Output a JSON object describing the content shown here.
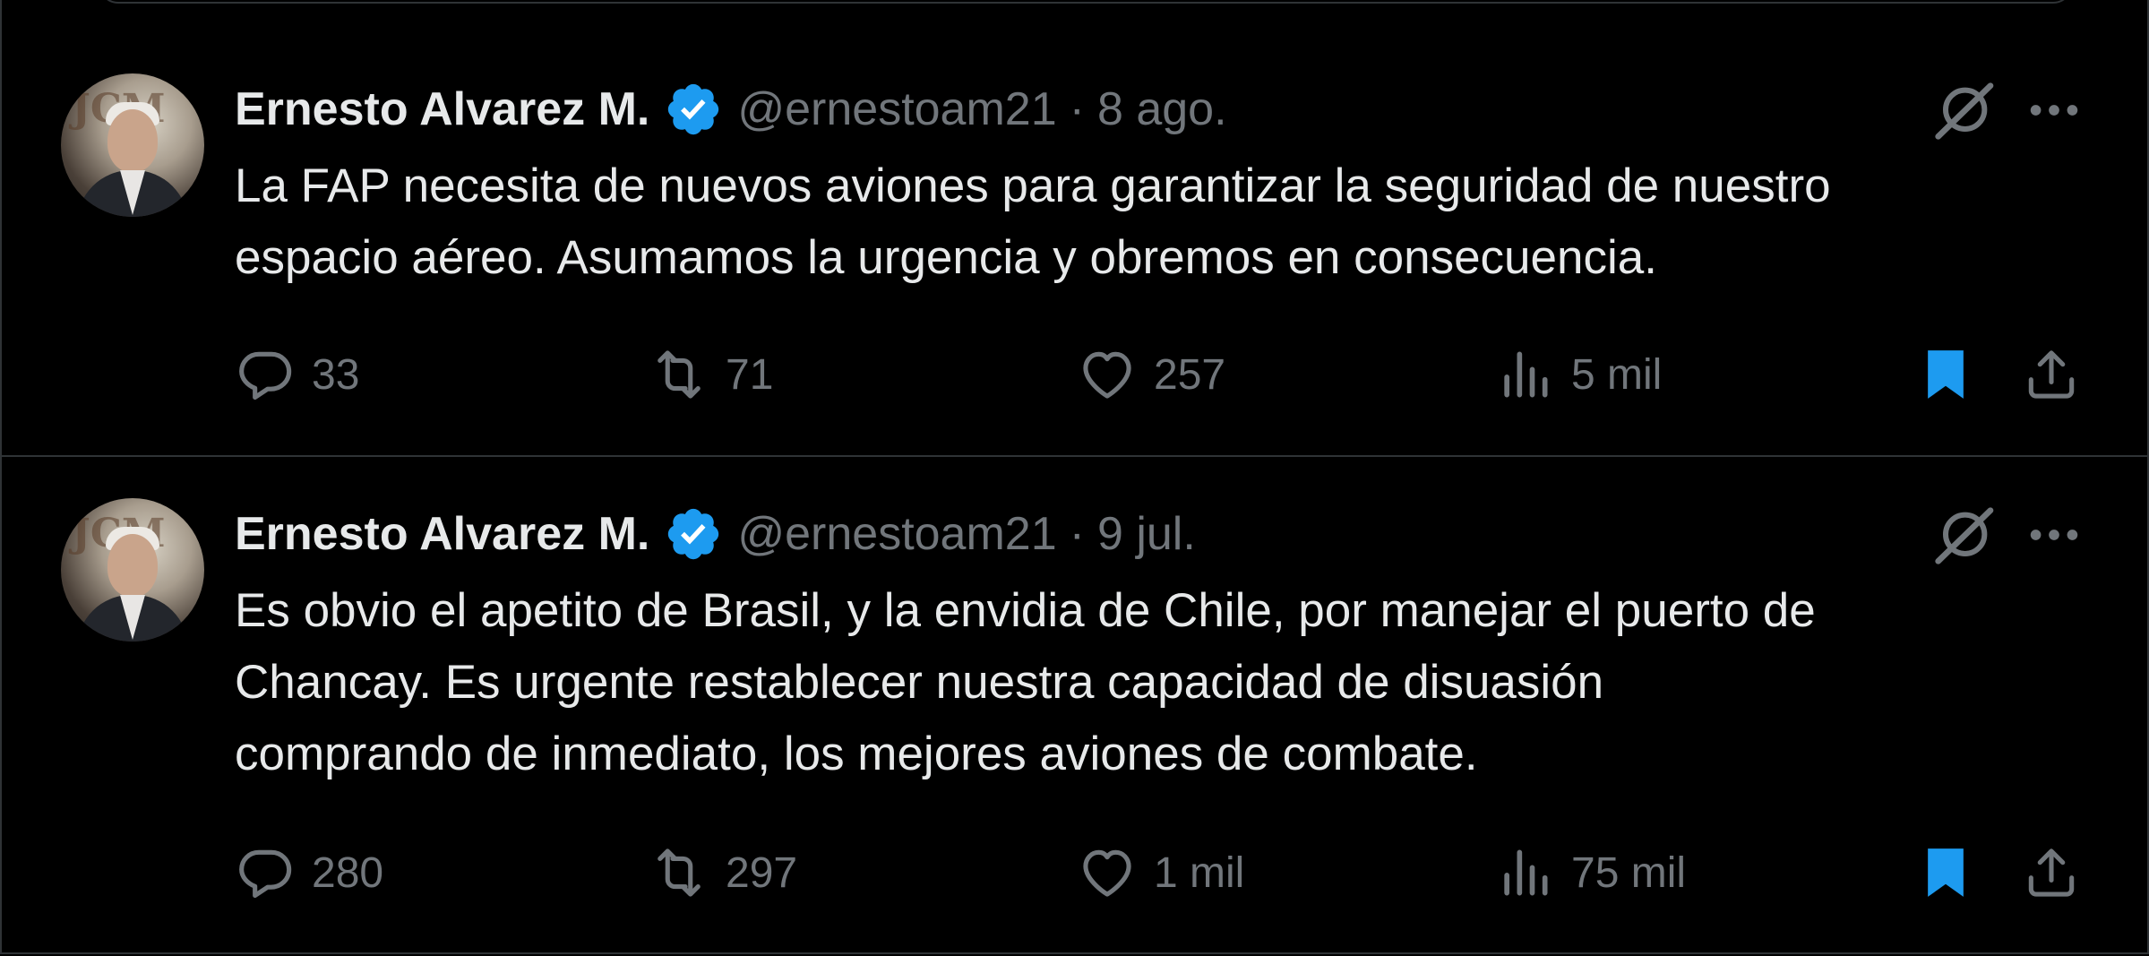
{
  "tweets": [
    {
      "author_name": "Ernesto Alvarez M.",
      "handle": "@ernestoam21",
      "separator": "·",
      "date": "8 ago.",
      "text": "La FAP necesita de nuevos aviones para garantizar la seguridad de nuestro\nespacio aéreo. Asumamos la urgencia y obremos en consecuencia.",
      "replies": "33",
      "retweets": "71",
      "likes": "257",
      "views": "5 mil",
      "bookmarked": true
    },
    {
      "author_name": "Ernesto Alvarez M.",
      "handle": "@ernestoam21",
      "separator": "·",
      "date": "9 jul.",
      "text": "Es obvio el apetito de Brasil, y la envidia de Chile, por manejar el puerto de\nChancay. Es urgente restablecer nuestra capacidad de disuasión\ncomprando de inmediato, los mejores aviones de combate.",
      "replies": "280",
      "retweets": "297",
      "likes": "1 mil",
      "views": "75 mil",
      "bookmarked": true
    }
  ],
  "icons": {
    "verified": "verified-badge-icon",
    "grok": "grok-icon",
    "more": "more-icon",
    "reply": "reply-icon",
    "retweet": "retweet-icon",
    "like": "heart-icon",
    "views": "views-icon",
    "bookmark": "bookmark-icon",
    "share": "share-icon"
  },
  "colors": {
    "background": "#000000",
    "text": "#e7e9ea",
    "secondary": "#71767b",
    "accent": "#1d9bf0",
    "divider": "#2f3336"
  }
}
